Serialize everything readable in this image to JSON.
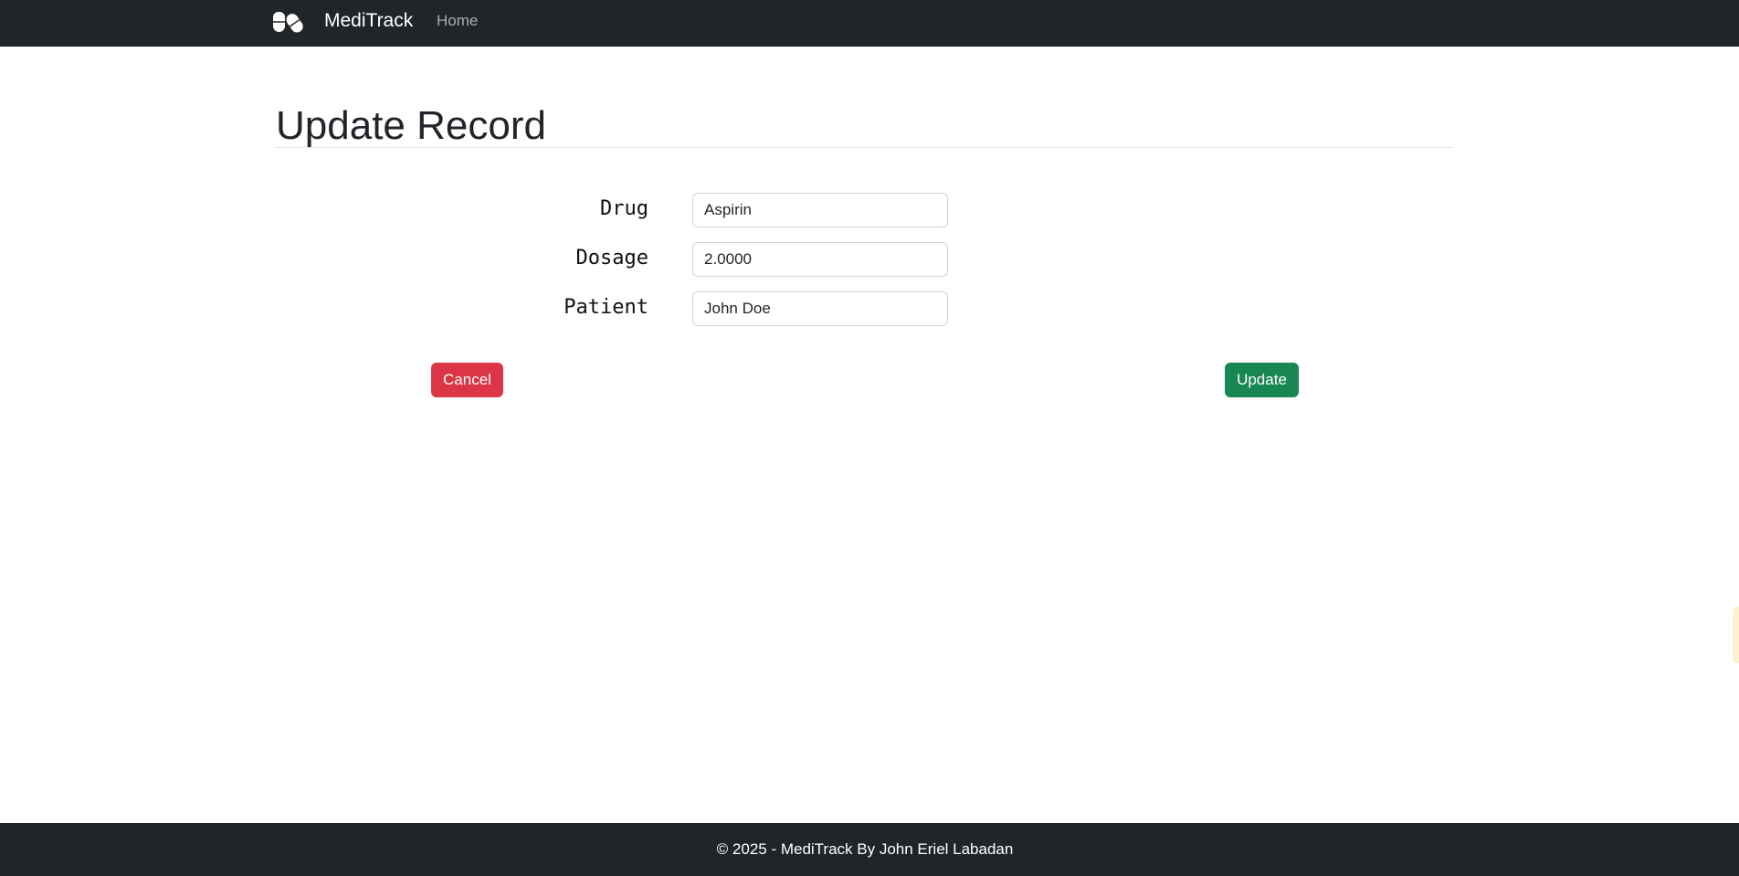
{
  "navbar": {
    "brand": "MediTrack",
    "logo_icon": "pills-icon",
    "home_label": "Home"
  },
  "main": {
    "title": "Update Record",
    "fields": {
      "drug": {
        "label": "Drug",
        "value": "Aspirin"
      },
      "dosage": {
        "label": "Dosage",
        "value": "2.0000"
      },
      "patient": {
        "label": "Patient",
        "value": "John Doe"
      }
    },
    "cancel_label": "Cancel",
    "update_label": "Update"
  },
  "footer": {
    "text": "© 2025 - MediTrack By John Eriel Labadan"
  },
  "colors": {
    "nav_bg": "#212529",
    "danger": "#dc3545",
    "success": "#198754"
  }
}
